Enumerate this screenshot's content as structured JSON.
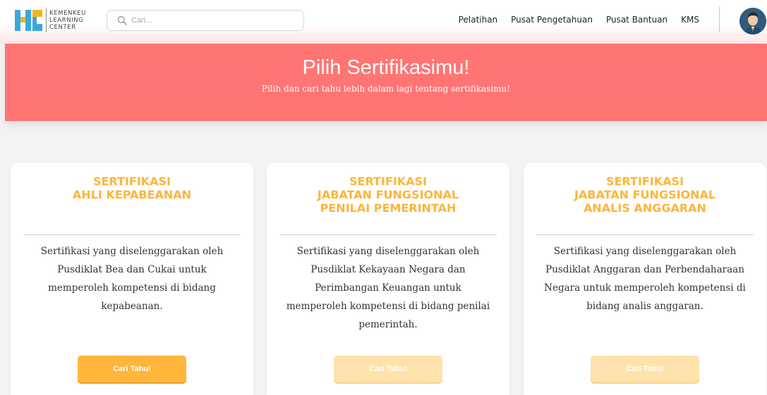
{
  "header": {
    "logo_lines": [
      "KEMENKEU",
      "LEARNING",
      "CENTER"
    ],
    "search_placeholder": "Cari...",
    "nav": [
      "Pelatihan",
      "Pusat Pengetahuan",
      "Pusat Bantuan",
      "KMS"
    ],
    "icons": {
      "search": "search-icon",
      "avatar": "user-avatar"
    }
  },
  "banner": {
    "title": "Pilih Sertifikasimu!",
    "subtitle": "Pilih dan cari tahu lebih dalam lagi tentang sertifikasimu!"
  },
  "cards": [
    {
      "title_lines": [
        "SERTIFIKASI",
        "AHLI KEPABEANAN"
      ],
      "desc_lines": [
        "Sertifikasi yang diselenggarakan oleh",
        "Pusdiklat Bea dan Cukai untuk",
        "memperoleh kompetensi di bidang",
        "kepabeanan."
      ],
      "button": "Cari Tahu!",
      "active": true
    },
    {
      "title_lines": [
        "SERTIFIKASI",
        "JABATAN FUNGSIONAL",
        "PENILAI PEMERINTAH"
      ],
      "desc_lines": [
        "Sertifikasi yang diselenggarakan oleh",
        "Pusdiklat Kekayaan Negara dan",
        "Perimbangan Keuangan untuk",
        "memperoleh kompetensi di bidang penilai",
        "pemerintah."
      ],
      "button": "Cari Tahu!",
      "active": false
    },
    {
      "title_lines": [
        "SERTIFIKASI",
        "JABATAN FUNGSIONAL",
        "ANALIS ANGGARAN"
      ],
      "desc_lines": [
        "Sertifikasi yang diselenggarakan oleh",
        "Pusdiklat Anggaran dan Perbendaharaan",
        "Negara untuk memperoleh kompetensi di",
        "bidang analis anggaran."
      ],
      "button": "Cari Tahu!",
      "active": false
    }
  ],
  "colors": {
    "banner": "#ff7574",
    "card_title": "#fbb53c",
    "button_active": "#ffb63b",
    "button_faded": "#ffe2ac"
  }
}
